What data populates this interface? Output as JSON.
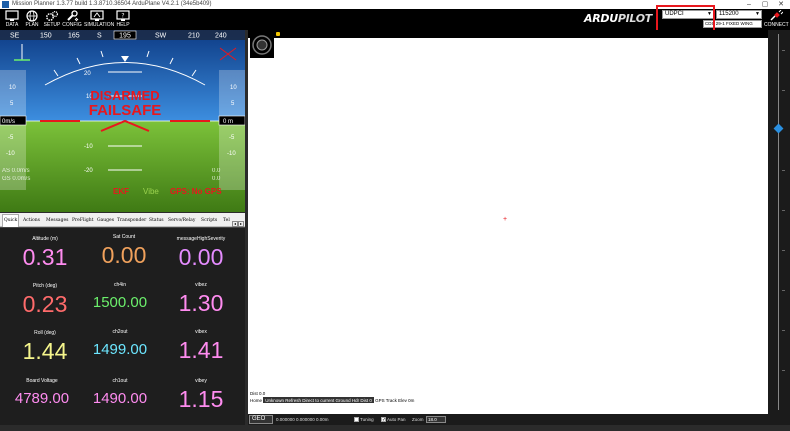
{
  "window": {
    "title": "Mission Planner 1.3.77 build 1.3.8710.36504 ArduPlane V4.2.1 (34e5b409)"
  },
  "toolbar": {
    "buttons": [
      {
        "label": "DATA",
        "icon": "monitor-icon"
      },
      {
        "label": "PLAN",
        "icon": "globe-icon"
      },
      {
        "label": "SETUP",
        "icon": "gears-icon"
      },
      {
        "label": "CONFIG",
        "icon": "wrench-icon"
      },
      {
        "label": "SIMULATION",
        "icon": "simulation-icon"
      },
      {
        "label": "HELP",
        "icon": "help-monitor-icon"
      }
    ],
    "logo_a": "ARDU",
    "logo_b": "PILOT",
    "port_value": "UDPCI",
    "baud_value": "115200",
    "frame_value": "CDS 29-1 FIXED WING",
    "connect_label": "CONNECT"
  },
  "hud": {
    "headings": [
      "SE",
      "150",
      "165",
      "S",
      "180",
      "210",
      "SW",
      "240"
    ],
    "heading_readout": "195",
    "status_disarmed": "DISARMED",
    "status_failsafe": "FAILSAFE",
    "speed_left": "0m/s",
    "alt_right": "0 m",
    "left_scale": [
      "10",
      "5",
      "-5",
      "-10"
    ],
    "right_scale": [
      "10",
      "5",
      "-5",
      "-10"
    ],
    "pitch_labels": [
      "20",
      "10",
      "-10",
      "-20"
    ],
    "left_info1": "AS 0.0m/s",
    "left_info2": "GS 0.0m/s",
    "right_info1": "0.0",
    "right_info2": "0.0",
    "ekf": "EKF",
    "vibe": "Vibe",
    "gps": "GPS: No GPS",
    "colors": {
      "sky": "#1a5fb4",
      "ground": "#6aa82e",
      "alert": "#e8171d"
    }
  },
  "tabs": [
    "Quick",
    "Actions",
    "Messages",
    "PreFlight",
    "Gauges",
    "Transponder",
    "Status",
    "Servo/Relay",
    "Scripts",
    "Tel"
  ],
  "quick": [
    {
      "label": "Altitude (m)",
      "value": "0.31",
      "color": "#ff8cf0"
    },
    {
      "label": "Sat Count",
      "value": "0.00",
      "color": "#f0a15c"
    },
    {
      "label": "messageHighSeverity",
      "value": "0.00",
      "color": "#e58cff"
    },
    {
      "label": "Pitch (deg)",
      "value": "0.23",
      "color": "#ff6b6b"
    },
    {
      "label": "ch4in",
      "value": "1500.00",
      "color": "#6cf06c"
    },
    {
      "label": "vibez",
      "value": "1.30",
      "color": "#ff8cf0"
    },
    {
      "label": "Roll (deg)",
      "value": "1.44",
      "color": "#f5f58c"
    },
    {
      "label": "ch2out",
      "value": "1499.00",
      "color": "#6ce6ff"
    },
    {
      "label": "vibex",
      "value": "1.41",
      "color": "#ff8cf0"
    },
    {
      "label": "Board Voltage",
      "value": "4789.00",
      "color": "#ff8cf0"
    },
    {
      "label": "ch1out",
      "value": "1490.00",
      "color": "#ff8cf0"
    },
    {
      "label": "vibey",
      "value": "1.15",
      "color": "#ff8cf0"
    }
  ],
  "map": {
    "info1": "Dist 0.0",
    "info2_label": "Home",
    "info2_bar": "Unknown   Refresh   Direct to current   Ground Hdr   Dist 0",
    "info2_tail": "GPS Track  Elev 0m"
  },
  "statusbar": {
    "geo_label": "GEO",
    "coords": "0.000000   0.000000    0.00m",
    "tuning_label": "Tuning",
    "autopan_label": "Auto Pan",
    "zoom_label": "Zoom",
    "zoom_value": "18.0"
  }
}
